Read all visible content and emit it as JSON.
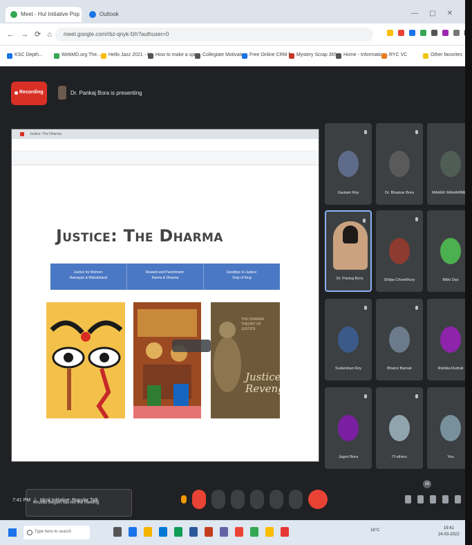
{
  "browser": {
    "tabs": [
      {
        "label": "Meet - Hul Initiative Pop",
        "active": true
      },
      {
        "label": "Outlook",
        "active": false
      }
    ],
    "url": "meet.google.com/rbz-qnyk-fzh?authuser=0",
    "bookmarks": [
      "KSC Depth...",
      "WebMD.org The...",
      "Hello Jazz 2021 - N...",
      "How to make a spir...",
      "Collegiate Motivatio...",
      "Free Online CRM f...",
      "Mystery Scrap 365...",
      "Home - Information...",
      "RYC VC",
      "Other favorites"
    ]
  },
  "meet": {
    "recording_label": "Recording",
    "presenting_label": "Dr. Pankaj Bora is presenting",
    "meeting_time": "7:41 PM",
    "meeting_title": "Idcol Initiative: Popular Talk",
    "participant_count": "16"
  },
  "slide": {
    "title": "Justice: The Dharma",
    "bands": [
      {
        "line1": "Justice for Women:",
        "line2": "Ramayan & Mahabharat"
      },
      {
        "line1": "Reward and Punishment:",
        "line2": "Karma & Dharma"
      },
      {
        "line1": "Goodbye to Justice:",
        "line2": "Duty of King"
      }
    ],
    "picture3_caption": "Justice Revenge",
    "picture3_header": "THE DHARMA\nTHEORY OF\nJUSTICE"
  },
  "toast": {
    "text": "Khusbu Begum has left the meeting"
  },
  "participants": [
    {
      "name": "Gautam Roy",
      "color": "#5f6b8a"
    },
    {
      "name": "Dr. Bhaskar Bora",
      "color": "#5a5a5a"
    },
    {
      "name": "MAHEK MAHAMMED",
      "color": "#4f5e54"
    },
    {
      "name": "Dr. Pankaj Bora",
      "color": "#caa27f"
    },
    {
      "name": "Shilpa Chowdhury",
      "color": "#8e3b2f"
    },
    {
      "name": "Bikki Das",
      "color": "#4caf50"
    },
    {
      "name": "Sudarshan Roy",
      "color": "#3b5a8a"
    },
    {
      "name": "Bhanvi Barnali",
      "color": "#6b7b8c"
    },
    {
      "name": "Rishika Rudrali",
      "color": "#8e24aa"
    },
    {
      "name": "Jagori Bora",
      "color": "#7b1fa2"
    },
    {
      "name": "IT-others",
      "color": "#90a4ae"
    },
    {
      "name": "You",
      "color": "#78909c"
    }
  ],
  "taskbar": {
    "search_placeholder": "Type here to search",
    "tray_text": "16°C",
    "time": "19:41",
    "date": "24-03-2022"
  }
}
